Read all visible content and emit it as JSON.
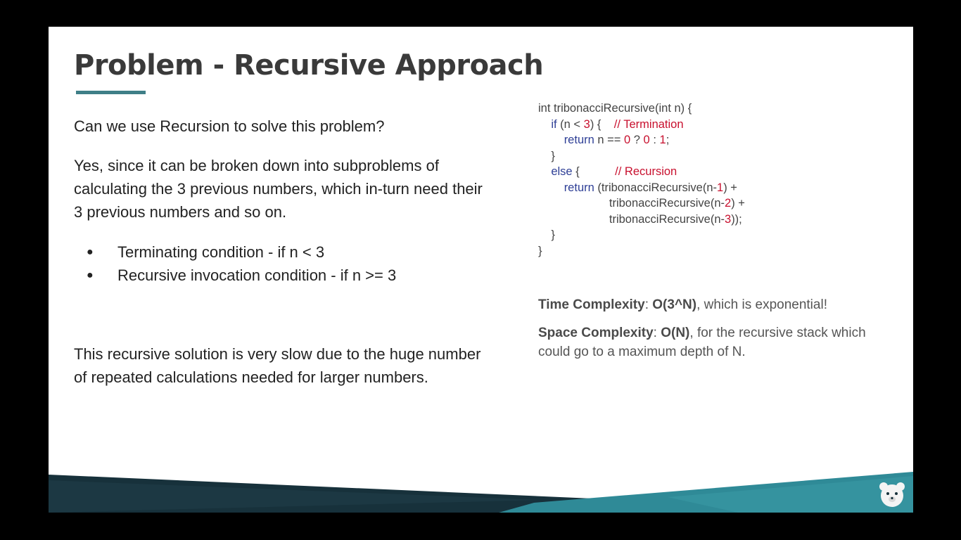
{
  "slide": {
    "title": "Problem - Recursive Approach",
    "question": "Can we use Recursion to solve this problem?",
    "answer": "Yes, since it can be broken down into subproblems of calculating the 3 previous numbers, which in-turn need their 3 previous numbers and so on.",
    "bullets": [
      "Terminating condition - if n < 3",
      "Recursive invocation condition - if n >= 3"
    ],
    "bullet_glyph": "●",
    "conclusion": "This recursive solution is very slow due to the huge number of repeated calculations needed for larger numbers."
  },
  "code": {
    "signature": "int tribonacciRecursive(int n) {",
    "if_kw": "if",
    "if_cond_a": " (n < ",
    "if_num": "3",
    "if_cond_b": ") {",
    "comment_termination": "// Termination",
    "return_kw": "return",
    "ret_a": " n == ",
    "ret_n0": "0",
    "ret_q": " ? ",
    "ret_n1": "0",
    "ret_c": " : ",
    "ret_n2": "1",
    "ret_end": ";",
    "close_brace": "}",
    "else_kw": "else",
    "else_brace": " {",
    "comment_recursion": "// Recursion",
    "return_kw2": "return",
    "call1_a": " (tribonacciRecursive(n-",
    "call1_n": "1",
    "call1_b": ") +",
    "call2_a": "tribonacciRecursive(n-",
    "call2_n": "2",
    "call2_b": ") +",
    "call3_a": "tribonacciRecursive(n-",
    "call3_n": "3",
    "call3_b": "));",
    "inner_close": "}",
    "outer_close": "}"
  },
  "complexity": {
    "time_label": "Time Complexity",
    "time_value": "O(3^N)",
    "time_note": ", which is exponential!",
    "space_label": "Space Complexity",
    "space_value": "O(N)",
    "space_note": ", for the recursive stack which could go to a maximum depth of N.",
    "separator": ": "
  },
  "colors": {
    "accent": "#3f7f87",
    "banner_dark": "#17313b",
    "banner_teal": "#2f8a97",
    "keyword": "#2e3f96",
    "literal": "#c8102e"
  },
  "icons": {
    "logo": "bear-logo-icon"
  }
}
